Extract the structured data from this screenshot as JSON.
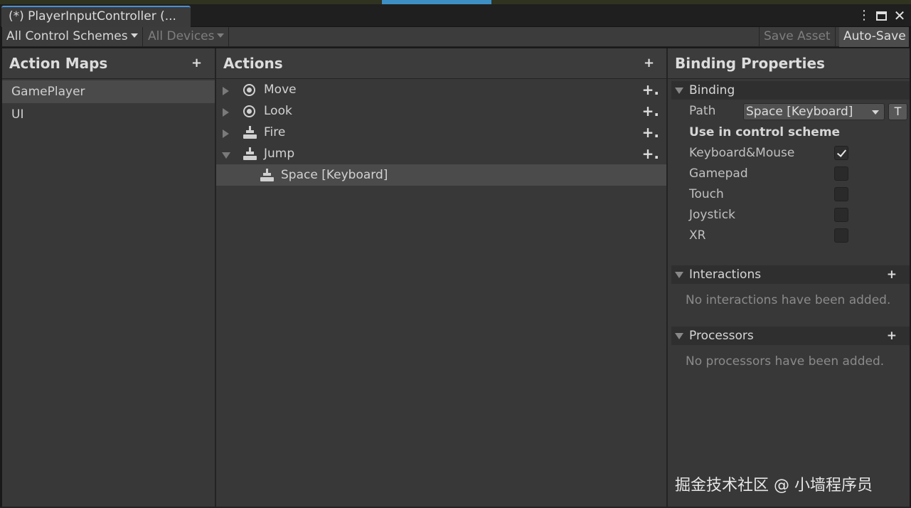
{
  "window": {
    "tab_title": "(*) PlayerInputController (...",
    "menu_icon": "kebab-menu-icon",
    "maximize_icon": "maximize-icon",
    "close_icon": "close-icon",
    "close_glyph": "✕"
  },
  "toolbar": {
    "control_schemes": "All Control Schemes",
    "devices": "All Devices",
    "save_asset": "Save Asset",
    "auto_save": "Auto-Save"
  },
  "action_maps": {
    "title": "Action Maps",
    "add": "+",
    "items": [
      {
        "label": "GamePlayer",
        "selected": true
      },
      {
        "label": "UI",
        "selected": false
      }
    ]
  },
  "actions": {
    "title": "Actions",
    "add": "+",
    "items": [
      {
        "label": "Move",
        "icon": "radial-icon",
        "expanded": false,
        "add": "+."
      },
      {
        "label": "Look",
        "icon": "radial-icon",
        "expanded": false,
        "add": "+."
      },
      {
        "label": "Fire",
        "icon": "button-icon",
        "expanded": false,
        "add": "+."
      },
      {
        "label": "Jump",
        "icon": "button-icon",
        "expanded": true,
        "add": "+."
      }
    ],
    "binding": {
      "label": "Space [Keyboard]",
      "icon": "button-icon",
      "selected": true
    }
  },
  "binding_properties": {
    "title": "Binding Properties",
    "binding_section": "Binding",
    "path_label": "Path",
    "path_value": "Space [Keyboard]",
    "t_button": "T",
    "use_in_scheme": "Use in control scheme",
    "schemes": [
      {
        "label": "Keyboard&Mouse",
        "checked": true
      },
      {
        "label": "Gamepad",
        "checked": false
      },
      {
        "label": "Touch",
        "checked": false
      },
      {
        "label": "Joystick",
        "checked": false
      },
      {
        "label": "XR",
        "checked": false
      }
    ],
    "interactions_section": "Interactions",
    "interactions_add": "+",
    "interactions_empty": "No interactions have been added.",
    "processors_section": "Processors",
    "processors_add": "+",
    "processors_empty": "No processors have been added."
  },
  "watermark": "掘金技术社区 @ 小墙程序员",
  "colors": {
    "panel_bg": "#383838",
    "selected_row": "#4b4b4b",
    "tab_accent": "#4a90d6",
    "section_bg": "#2f2f2f"
  }
}
